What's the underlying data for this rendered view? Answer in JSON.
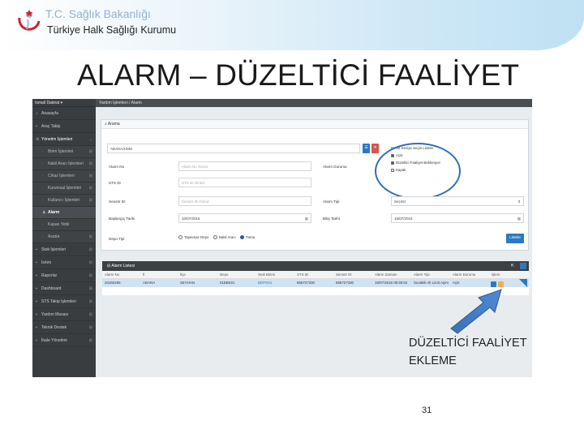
{
  "header": {
    "org_title": "T.C. Sağlık Bakanlığı",
    "org_subtitle": "Türkiye Halk Sağlığı Kurumu"
  },
  "slide_title": "ALARM – DÜZELTİCİ FAALİYET",
  "app": {
    "user": "Ismail Dakirat ▾",
    "breadcrumb": "Yardım İşlemleri / Alarm",
    "sidebar": {
      "items": [
        {
          "label": "Anasayfa",
          "icon": "home-icon"
        },
        {
          "label": "Araç Takip",
          "icon": "truck-icon"
        },
        {
          "label": "Yönetim İşlemleri",
          "icon": "gear-icon"
        },
        {
          "label": "Birim İşlemleri",
          "icon": "building-icon"
        },
        {
          "label": "Nakil Aracı İşlemleri",
          "icon": "car-icon"
        },
        {
          "label": "Cihaz İşlemleri",
          "icon": "device-icon"
        },
        {
          "label": "Kurumsal İşlemleri",
          "icon": "users-icon"
        },
        {
          "label": "Kullanıcı İşlemleri",
          "icon": "user-icon"
        },
        {
          "label": "Alarm",
          "icon": "bell-icon"
        },
        {
          "label": "Kapan Yetki",
          "icon": "key-icon"
        },
        {
          "label": "Asatür",
          "icon": "list-icon"
        },
        {
          "label": "Stok İşlemleri",
          "icon": "box-icon"
        },
        {
          "label": "Isıtım",
          "icon": "thermo-icon"
        },
        {
          "label": "Raporlar",
          "icon": "report-icon"
        },
        {
          "label": "Dashboard",
          "icon": "dashboard-icon"
        },
        {
          "label": "STS Takip İşlemleri",
          "icon": "track-icon"
        },
        {
          "label": "Yardım Masası",
          "icon": "help-icon"
        },
        {
          "label": "Teknik Destek",
          "icon": "wrench-icon"
        },
        {
          "label": "İhale Yönetimi",
          "icon": "gavel-icon"
        }
      ]
    },
    "search_panel": {
      "title": "Arama",
      "province_value": "ADANA/HSM",
      "labels": {
        "alarm_no": "Alarm No",
        "sts_id": "STS ID",
        "sensor_id": "Sensör ID",
        "start_date": "Başlangıç Tarihi",
        "depot_type": "Depo Tipi",
        "alarm_status": "Alarm Durumu",
        "alarm_type": "Alarm Tipi",
        "end_date": "Bitiş Tarihi"
      },
      "placeholders": {
        "alarm_no": "Alarm No Giriniz",
        "sts_id": "STS ID Giriniz",
        "sensor_id": "Sensör ID Giriniz"
      },
      "start_date_value": "10/07/2016",
      "end_date_value": "15/07/2016",
      "alarm_type_value": "Seçiniz",
      "status_options_title": "Bir Alt Seviye Seçin Listele",
      "status_options": [
        {
          "label": "Açık",
          "checked": true
        },
        {
          "label": "Düzeltici Faaliyet Bekleniyor",
          "checked": true
        },
        {
          "label": "Kapalı",
          "checked": false
        }
      ],
      "depot_radios": [
        {
          "label": "Taşınmaz Depo",
          "checked": false
        },
        {
          "label": "Nakil Aracı",
          "checked": false
        },
        {
          "label": "Tümü",
          "checked": true
        }
      ],
      "search_button": "Listele"
    },
    "alarm_list": {
      "title": "Alarm Listesi",
      "columns": [
        "Alarm No",
        "İl",
        "İlçe",
        "Depo",
        "Stok Birimi",
        "STS ID",
        "Sensör ID",
        "Alarm Zamanı",
        "Alarm Tipi",
        "Alarm Durumu",
        "İşlem"
      ],
      "rows": [
        [
          "20160296",
          "ADANA",
          "SEYHAN",
          "01EBK01",
          "DEPO01",
          "865727330",
          "865727330",
          "15/07/2016 08:36:02",
          "Sıcaklık Alt Limit Aşım",
          "Açık",
          ""
        ]
      ]
    }
  },
  "annotation": {
    "line1": "DÜZELTİCİ FAALİYET",
    "line2": "EKLEME"
  },
  "page_number": "31",
  "colors": {
    "accent": "#2b79c2",
    "sidebar": "#3a3d40",
    "highlight_row": "#cfe3f3",
    "circle": "#2f6fb6"
  }
}
